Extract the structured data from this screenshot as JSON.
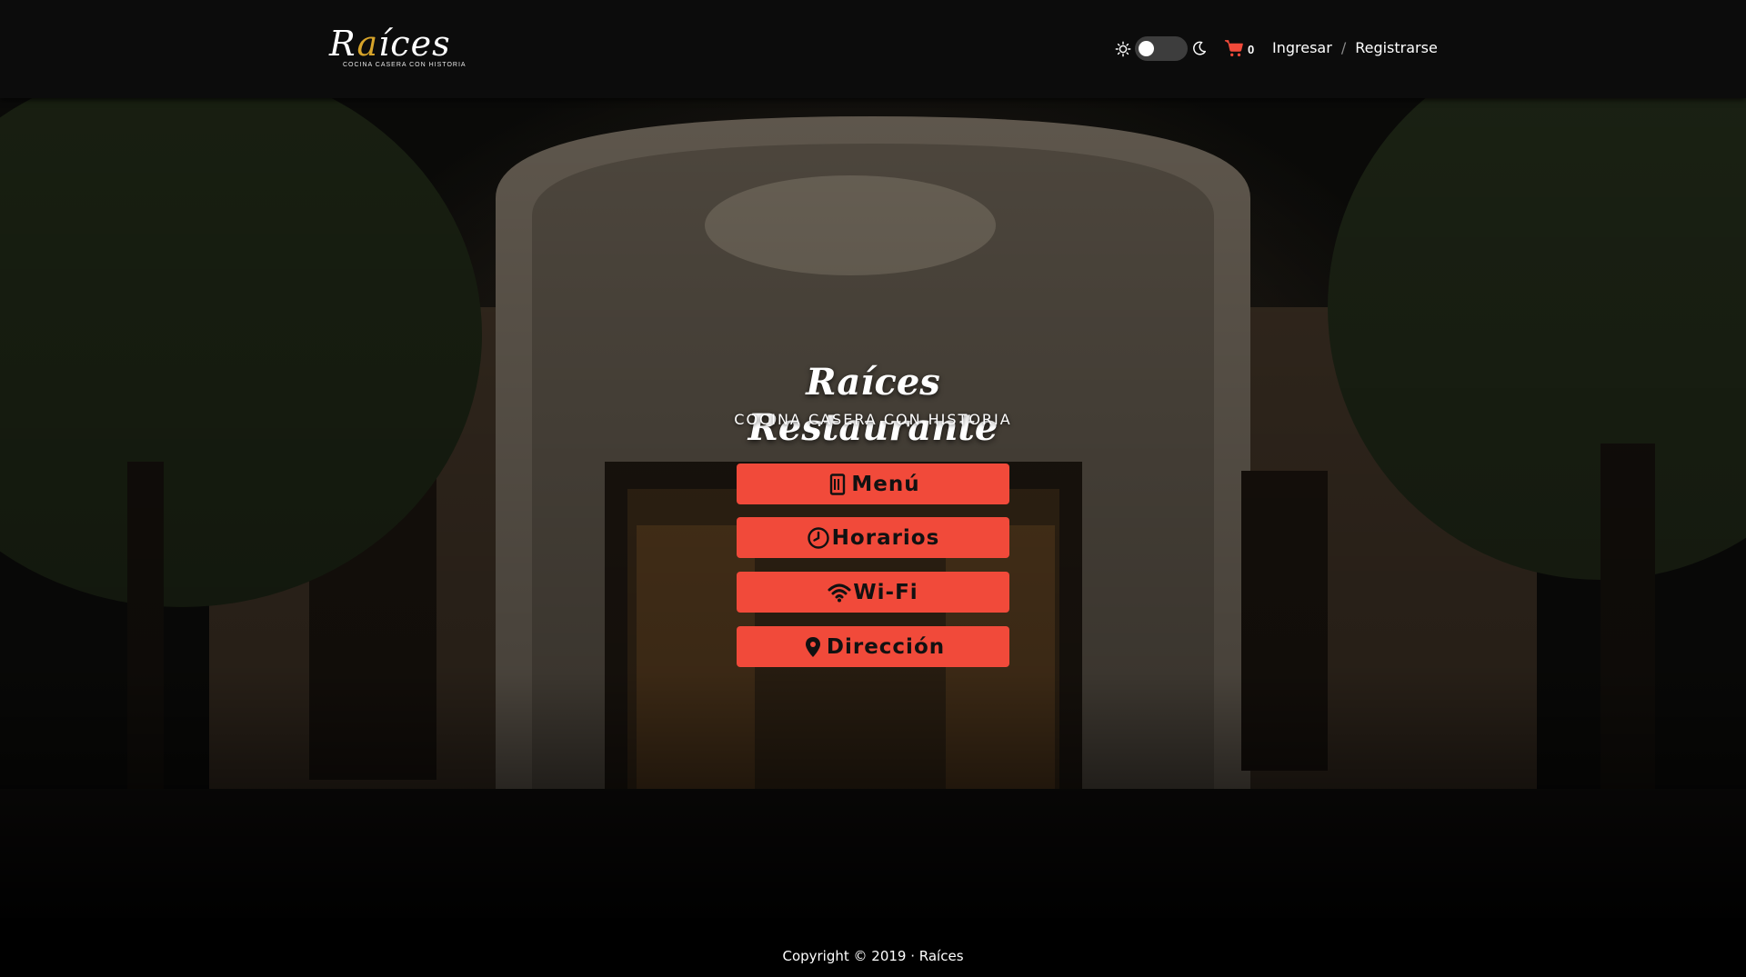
{
  "header": {
    "logo_text_prefix": "R",
    "logo_text_accent": "a",
    "logo_text_suffix": "íces",
    "logo_tagline": "COCINA CASERA CON HISTORIA",
    "cart_count": "0",
    "login_label": "Ingresar",
    "separator": "/",
    "register_label": "Registrarse",
    "theme_dark_mode": false,
    "icons": [
      "sun-icon",
      "moon-icon",
      "cart-icon"
    ]
  },
  "hero": {
    "title": "Raíces Restaurante",
    "subtitle": "COCINA CASERA CON HISTORIA",
    "buttons": [
      {
        "label": "Menú",
        "icon": "menu-book-icon"
      },
      {
        "label": "Horarios",
        "icon": "clock-icon"
      },
      {
        "label": "Wi-Fi",
        "icon": "wifi-icon"
      },
      {
        "label": "Dirección",
        "icon": "location-pin-icon"
      }
    ]
  },
  "footer": {
    "copyright": "Copyright © 2019 · Raíces"
  },
  "colors": {
    "accent": "#f14a3a",
    "header_bg": "#0c0c0c",
    "cart": "#f14a3a",
    "logo_accent": "#d7a42a"
  }
}
